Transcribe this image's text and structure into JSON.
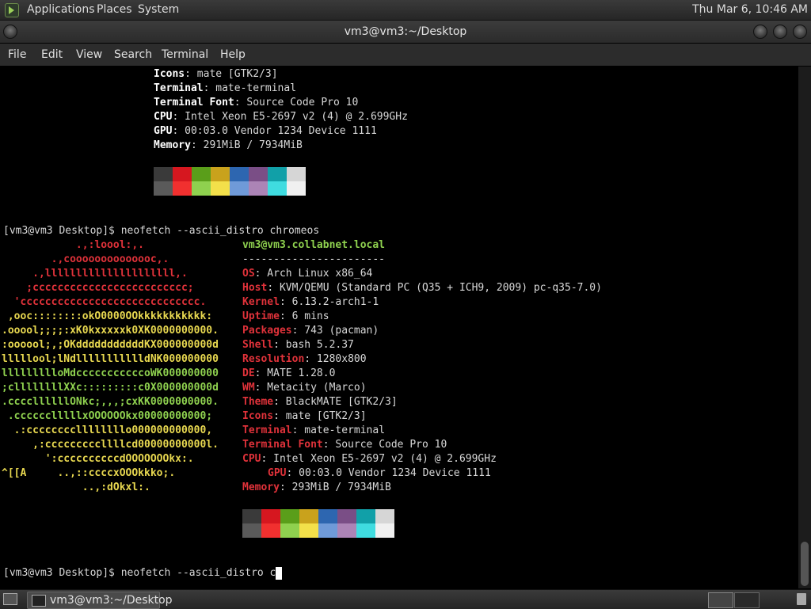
{
  "top_panel": {
    "menus": [
      "Applications",
      "Places",
      "System"
    ],
    "clock": "Thu Mar  6, 10:46 AM"
  },
  "window": {
    "title": "vm3@vm3:~/Desktop",
    "menu": [
      "File",
      "Edit",
      "View",
      "Search",
      "Terminal",
      "Help"
    ]
  },
  "upper_info": [
    {
      "key": "Icons",
      "value": "mate [GTK2/3]"
    },
    {
      "key": "Terminal",
      "value": "mate-terminal"
    },
    {
      "key": "Terminal Font",
      "value": "Source Code Pro 10"
    },
    {
      "key": "CPU",
      "value": "Intel Xeon E5-2697 v2 (4) @ 2.699GHz"
    },
    {
      "key": "GPU",
      "value": "00:03.0 Vendor 1234 Device 1111"
    },
    {
      "key": "Memory",
      "value": "291MiB / 7934MiB"
    }
  ],
  "palette_dark": [
    "#3a3a3a",
    "#d6171f",
    "#5a9e1a",
    "#c9a21c",
    "#2d66b0",
    "#7a4e86",
    "#11a0a8",
    "#d6d6d6"
  ],
  "palette_bright": [
    "#5a5a5a",
    "#f1302f",
    "#8fd14f",
    "#f3e04a",
    "#6f9ad8",
    "#ac84b6",
    "#3fdce0",
    "#f0f0f0"
  ],
  "command1": "[vm3@vm3 Desktop]$ neofetch --ascii_distro chromeos",
  "host_line": "vm3@vm3.collabnet.local",
  "dashes": "-----------------------",
  "info": [
    {
      "key": "OS",
      "value": "Arch Linux x86_64"
    },
    {
      "key": "Host",
      "value": "KVM/QEMU (Standard PC (Q35 + ICH9, 2009) pc-q35-7.0)"
    },
    {
      "key": "Kernel",
      "value": "6.13.2-arch1-1"
    },
    {
      "key": "Uptime",
      "value": "6 mins"
    },
    {
      "key": "Packages",
      "value": "743 (pacman)"
    },
    {
      "key": "Shell",
      "value": "bash 5.2.37"
    },
    {
      "key": "Resolution",
      "value": "1280x800"
    },
    {
      "key": "DE",
      "value": "MATE 1.28.0"
    },
    {
      "key": "WM",
      "value": "Metacity (Marco)"
    },
    {
      "key": "Theme",
      "value": "BlackMATE [GTK2/3]"
    },
    {
      "key": "Icons",
      "value": "mate [GTK2/3]"
    },
    {
      "key": "Terminal",
      "value": "mate-terminal"
    },
    {
      "key": "Terminal Font",
      "value": "Source Code Pro 10"
    },
    {
      "key": "CPU",
      "value": "Intel Xeon E5-2697 v2 (4) @ 2.699GHz"
    },
    {
      "key": "GPU",
      "value": "00:03.0 Vendor 1234 Device 1111"
    },
    {
      "key": "Memory",
      "value": "293MiB / 7934MiB"
    }
  ],
  "ascii": [
    {
      "text": "            .,:loool:,.",
      "color": "#e0323a"
    },
    {
      "text": "        .,coooooooooooooc,.",
      "color": "#e0323a"
    },
    {
      "text": "     .,lllllllllllllllllllll,.",
      "color": "#e0323a"
    },
    {
      "text": "    ;ccccccccccccccccccccccccc;",
      "color": "#e0323a"
    },
    {
      "text": "  'ccccccccccccccccccccccccccccc.",
      "color": "#e0323a"
    },
    {
      "text": " ,ooc::::::::okO0000OOkkkkkkkkkkk:",
      "color": "#e8d850"
    },
    {
      "text": ".ooool;;;;:xK0kxxxxxk0XK0000000000.",
      "color": "#e8d850"
    },
    {
      "text": ":oooool;,;OKdddddddddddKX000000000d",
      "color": "#e8d850"
    },
    {
      "text": "lllllool;lNdllllllllllldNK000000000",
      "color": "#e8d850"
    },
    {
      "text": "llllllllloMdcccccccccccoWK000000000",
      "color": "#8fd14f"
    },
    {
      "text": ";cllllllllXXc:::::::::c0X000000000d",
      "color": "#8fd14f"
    },
    {
      "text": ".ccccllllllONkc;,,,;cxKK0000000000.",
      "color": "#8fd14f"
    },
    {
      "text": " .cccccclllllxOOOOOOkx00000000000;",
      "color": "#8fd14f"
    },
    {
      "text": "  .:ccccccccllllllllo000000000000,",
      "color": "#e8d850"
    },
    {
      "text": "     ,:cccccccccllllcd00000000000l.",
      "color": "#e8d850"
    },
    {
      "text": "       ':ccccccccccdOOOOOOOkx:.",
      "color": "#e8d850"
    },
    {
      "text": "^[[A     ..,::ccccxOOOkkko;.",
      "color": "#e8d850"
    },
    {
      "text": "             ..,:dOkxl:.",
      "color": "#e8d850"
    }
  ],
  "command2": "[vm3@vm3 Desktop]$ neofetch --ascii_distro c",
  "taskbar": {
    "task_label": "vm3@vm3:~/Desktop"
  }
}
